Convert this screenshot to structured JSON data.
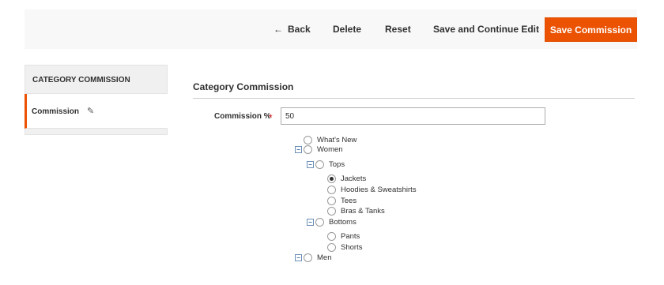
{
  "toolbar": {
    "back_label": "Back",
    "delete_label": "Delete",
    "reset_label": "Reset",
    "save_continue_label": "Save and Continue Edit",
    "save_label": "Save Commission"
  },
  "sidebar": {
    "heading": "CATEGORY COMMISSION",
    "items": [
      {
        "label": "Commission"
      }
    ]
  },
  "main": {
    "section_title": "Category Commission",
    "commission_field": {
      "label": "Commission %",
      "required_mark": "*",
      "value": "50"
    }
  },
  "tree": [
    {
      "label": "What's New",
      "checked": false,
      "expandable": false
    },
    {
      "label": "Women",
      "checked": false,
      "expandable": true
    },
    {
      "label": "Tops",
      "checked": false,
      "expandable": true
    },
    {
      "label": "Jackets",
      "checked": true,
      "expandable": false
    },
    {
      "label": "Hoodies & Sweatshirts",
      "checked": false,
      "expandable": false
    },
    {
      "label": "Tees",
      "checked": false,
      "expandable": false
    },
    {
      "label": "Bras & Tanks",
      "checked": false,
      "expandable": false
    },
    {
      "label": "Bottoms",
      "checked": false,
      "expandable": true
    },
    {
      "label": "Pants",
      "checked": false,
      "expandable": false
    },
    {
      "label": "Shorts",
      "checked": false,
      "expandable": false
    },
    {
      "label": "Men",
      "checked": false,
      "expandable": true
    }
  ],
  "colors": {
    "accent": "#eb5202",
    "required": "#e22626"
  }
}
